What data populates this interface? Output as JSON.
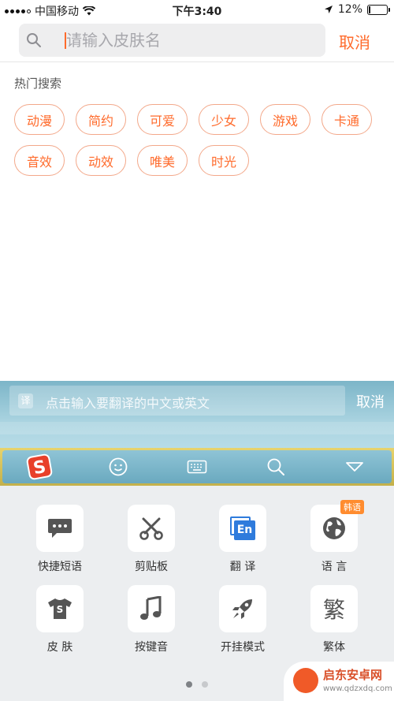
{
  "status_bar": {
    "carrier": "中国移动",
    "time": "下午3:40",
    "battery": "12%",
    "battery_level": 0.12
  },
  "search": {
    "placeholder": "请输入皮肤名",
    "cancel_label": "取消"
  },
  "hot": {
    "title": "热门搜索",
    "tags": [
      "动漫",
      "简约",
      "可爱",
      "少女",
      "游戏",
      "卡通",
      "音效",
      "动效",
      "唯美",
      "时光"
    ]
  },
  "translate": {
    "icon_text": "译",
    "placeholder": "点击输入要翻译的中文或英文",
    "cancel_label": "取消"
  },
  "keyboard": {
    "logo_text": "S",
    "functions": [
      {
        "label": "快捷短语",
        "icon": "message-icon"
      },
      {
        "label": "剪贴板",
        "icon": "scissors-icon"
      },
      {
        "label": "翻 译",
        "icon": "translate-icon",
        "icon_text": "En"
      },
      {
        "label": "语 言",
        "icon": "globe-icon",
        "badge": "韩语"
      },
      {
        "label": "皮 肤",
        "icon": "tshirt-icon",
        "icon_text": "S"
      },
      {
        "label": "按键音",
        "icon": "music-note-icon"
      },
      {
        "label": "开挂模式",
        "icon": "rocket-icon"
      },
      {
        "label": "繁体",
        "icon": "traditional-char-icon",
        "icon_text": "繁"
      }
    ],
    "page_count": 2,
    "active_page": 1
  },
  "watermark": {
    "title": "启东安卓网",
    "url": "www.qdzxdq.com"
  },
  "colors": {
    "accent": "#ff6b2c",
    "tag_border": "#f3a88a",
    "keyboard_bg": "#eceef0"
  }
}
